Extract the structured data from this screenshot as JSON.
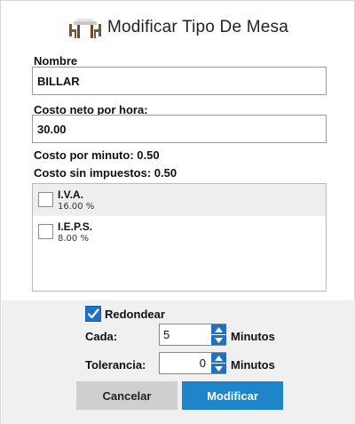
{
  "dialog": {
    "title": "Modificar Tipo De Mesa",
    "icon": "table-chairs-icon"
  },
  "form": {
    "nombre_label": "Nombre",
    "nombre_value": "BILLAR",
    "costo_label": "Costo neto por hora:",
    "costo_value": "30.00",
    "costo_minuto": "Costo por minuto: 0.50",
    "costo_sin_impuestos": "Costo sin impuestos: 0.50"
  },
  "taxes": [
    {
      "name": "I.V.A.",
      "rate": "16.00 %",
      "checked": false
    },
    {
      "name": "I.E.P.S.",
      "rate": "8.00 %",
      "checked": false
    }
  ],
  "options": {
    "redondear_label": "Redondear",
    "redondear_checked": true,
    "cada_label": "Cada:",
    "cada_value": "5",
    "cada_unit": "Minutos",
    "tolerancia_label": "Tolerancia:",
    "tolerancia_value": "0",
    "tolerancia_unit": "Minutos"
  },
  "buttons": {
    "cancel": "Cancelar",
    "ok": "Modificar"
  },
  "colors": {
    "accent": "#1d85c8",
    "checkbox": "#1d72c6"
  }
}
